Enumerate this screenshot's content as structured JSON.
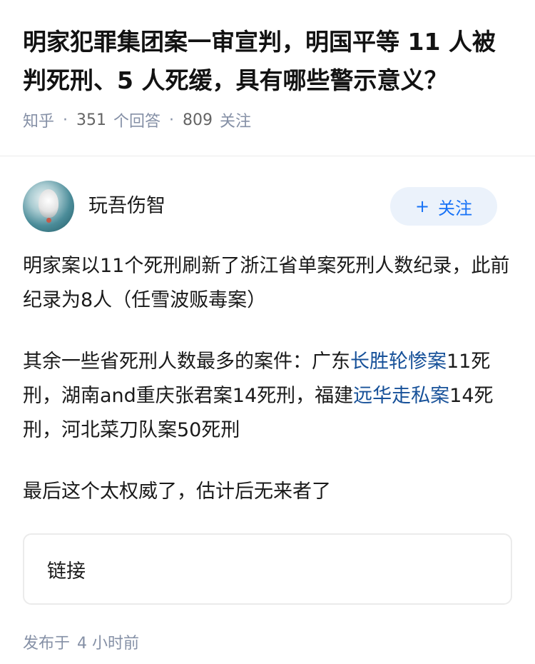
{
  "question": {
    "title": "明家犯罪集团案一审宣判，明国平等 11 人被判死刑、5 人死缓，具有哪些警示意义？",
    "source": "知乎",
    "answers_count": "351",
    "answers_label": "个回答",
    "followers_count": "809",
    "followers_label": "关注"
  },
  "author": {
    "name": "玩吾伤智",
    "avatar_icon": "tiger-avatar",
    "follow_label": "关注",
    "follow_icon": "plus-icon",
    "accent_color": "#1772f6"
  },
  "answer": {
    "p1": "明家案以11个死刑刷新了浙江省单案死刑人数纪录，此前纪录为8人（任雪波贩毒案）",
    "p2_part1": "其余一些省死刑人数最多的案件：广东",
    "p2_link1": "长胜轮惨案",
    "p2_part2": "11死刑，湖南and重庆张君案14死刑，福建",
    "p2_link2": "远华走私案",
    "p2_part3": "14死刑，河北菜刀队案50死刑",
    "p3": "最后这个太权威了，估计后无来者了",
    "link_color": "#175199"
  },
  "link_card": {
    "label": "链接"
  },
  "footer": {
    "published_label": "发布于",
    "published_time": "4 小时前"
  }
}
